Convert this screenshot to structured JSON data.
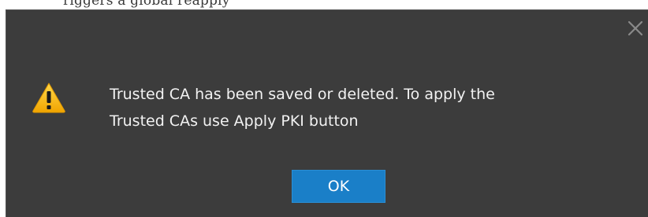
{
  "background_text": "riggers a global reapply",
  "dialog": {
    "message_line1": "Trusted CA has been saved or deleted. To apply the",
    "message_line2": "Trusted CAs use Apply PKI button",
    "ok_label": "OK",
    "icon": "warning-icon",
    "close_icon": "close-icon"
  },
  "colors": {
    "dialog_background": "#3c3c3c",
    "button_background": "#1a7fc8",
    "warning_yellow": "#f5b800",
    "text": "#f2f2f2"
  }
}
